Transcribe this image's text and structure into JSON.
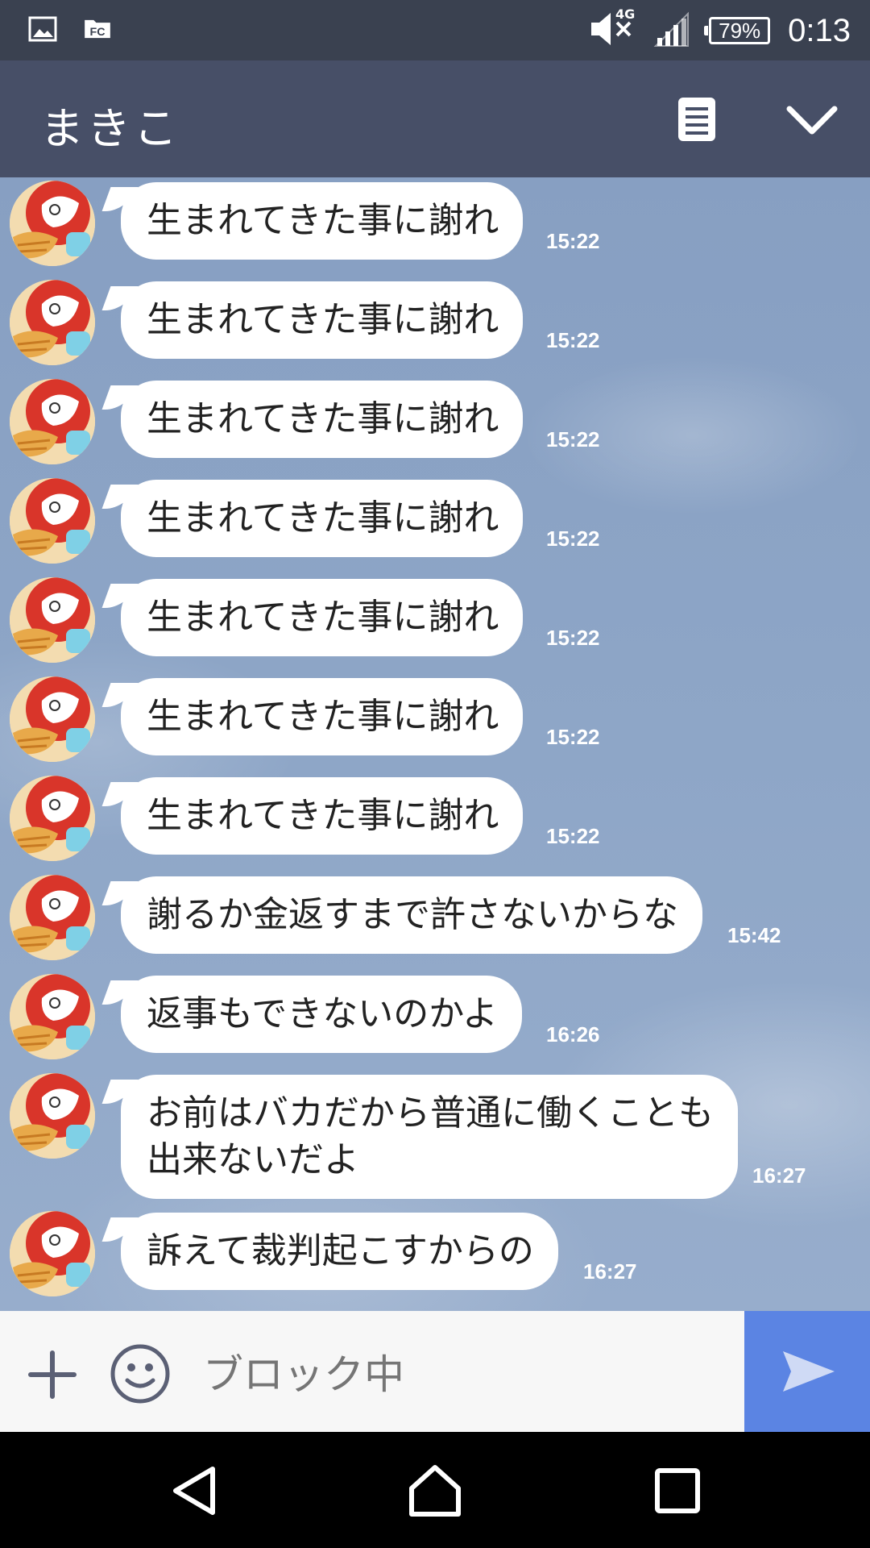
{
  "status_bar": {
    "network_label": "4G",
    "battery": "79%",
    "time": "0:13"
  },
  "header": {
    "title": "まきこ"
  },
  "messages": [
    {
      "text": "生まれてきた事に謝れ",
      "time": "15:22"
    },
    {
      "text": "生まれてきた事に謝れ",
      "time": "15:22"
    },
    {
      "text": "生まれてきた事に謝れ",
      "time": "15:22"
    },
    {
      "text": "生まれてきた事に謝れ",
      "time": "15:22"
    },
    {
      "text": "生まれてきた事に謝れ",
      "time": "15:22"
    },
    {
      "text": "生まれてきた事に謝れ",
      "time": "15:22"
    },
    {
      "text": "生まれてきた事に謝れ",
      "time": "15:22"
    },
    {
      "text": "謝るか金返すまで許さないからな",
      "time": "15:42"
    },
    {
      "text": "返事もできないのかよ",
      "time": "16:26"
    },
    {
      "text": "お前はバカだから普通に働くことも出来ないだよ",
      "time": "16:27"
    },
    {
      "text": "訴えて裁判起こすからの",
      "time": "16:27"
    }
  ],
  "input": {
    "placeholder": "ブロック中"
  },
  "colors": {
    "status_bar": "#3a4150",
    "header": "#474f67",
    "send_button": "#5b84e3",
    "chat_background": "#8ea6c7"
  },
  "icons": {
    "status_left": [
      "gallery-icon",
      "app-notification-icon"
    ],
    "status_right": [
      "mute-icon",
      "signal-icon",
      "battery-icon"
    ],
    "header": [
      "memo-icon",
      "chevron-down-icon"
    ],
    "input": [
      "plus-icon",
      "emoji-icon",
      "send-icon"
    ],
    "nav": [
      "back-icon",
      "home-icon",
      "recents-icon"
    ]
  }
}
